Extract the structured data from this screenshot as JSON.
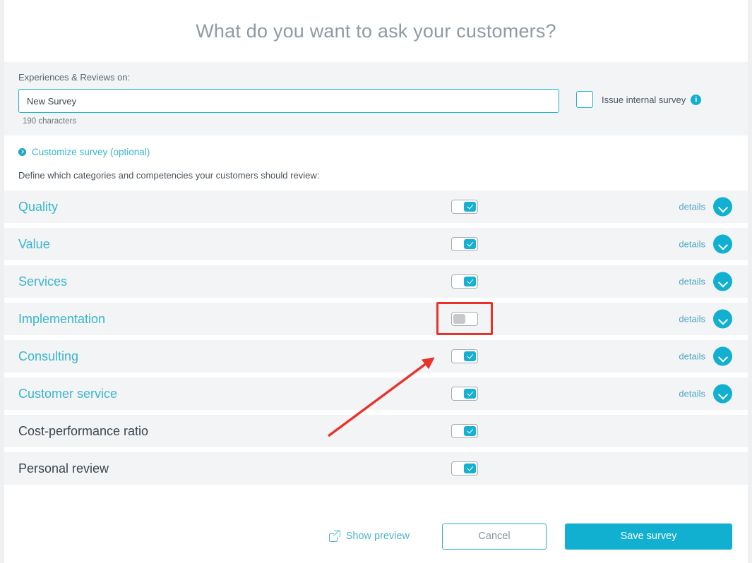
{
  "header": {
    "title": "What do you want to ask your customers?"
  },
  "survey_name": {
    "label": "Experiences & Reviews on:",
    "value": "New Survey",
    "placeholder": "",
    "char_count": "190 characters",
    "internal_checkbox_label": "Issue internal survey",
    "internal_checkbox_checked": false,
    "info_icon_glyph": "i",
    "info_icon_name": "info-icon"
  },
  "customize": {
    "link_label": "Customize survey (optional)",
    "description": "Define which categories and competencies your customers should review:"
  },
  "categories": [
    {
      "label": "Quality",
      "enabled": true,
      "teal": true,
      "has_details": true,
      "details_label": "details"
    },
    {
      "label": "Value",
      "enabled": true,
      "teal": true,
      "has_details": true,
      "details_label": "details"
    },
    {
      "label": "Services",
      "enabled": true,
      "teal": true,
      "has_details": true,
      "details_label": "details"
    },
    {
      "label": "Implementation",
      "enabled": false,
      "teal": true,
      "has_details": true,
      "details_label": "details",
      "highlighted": true
    },
    {
      "label": "Consulting",
      "enabled": true,
      "teal": true,
      "has_details": true,
      "details_label": "details"
    },
    {
      "label": "Customer service",
      "enabled": true,
      "teal": true,
      "has_details": true,
      "details_label": "details"
    },
    {
      "label": "Cost-performance ratio",
      "enabled": true,
      "teal": false,
      "has_details": false,
      "details_label": ""
    },
    {
      "label": "Personal review",
      "enabled": true,
      "teal": false,
      "has_details": false,
      "details_label": ""
    }
  ],
  "footer": {
    "preview_label": "Show preview",
    "cancel_label": "Cancel",
    "save_label": "Save survey"
  },
  "colors": {
    "accent": "#11afd0",
    "accent_text": "#3ab5cf",
    "row_bg": "#f2f4f5",
    "title": "#8f9aa3",
    "dark_text": "#3c464e",
    "annotation_red": "#e8322a"
  }
}
